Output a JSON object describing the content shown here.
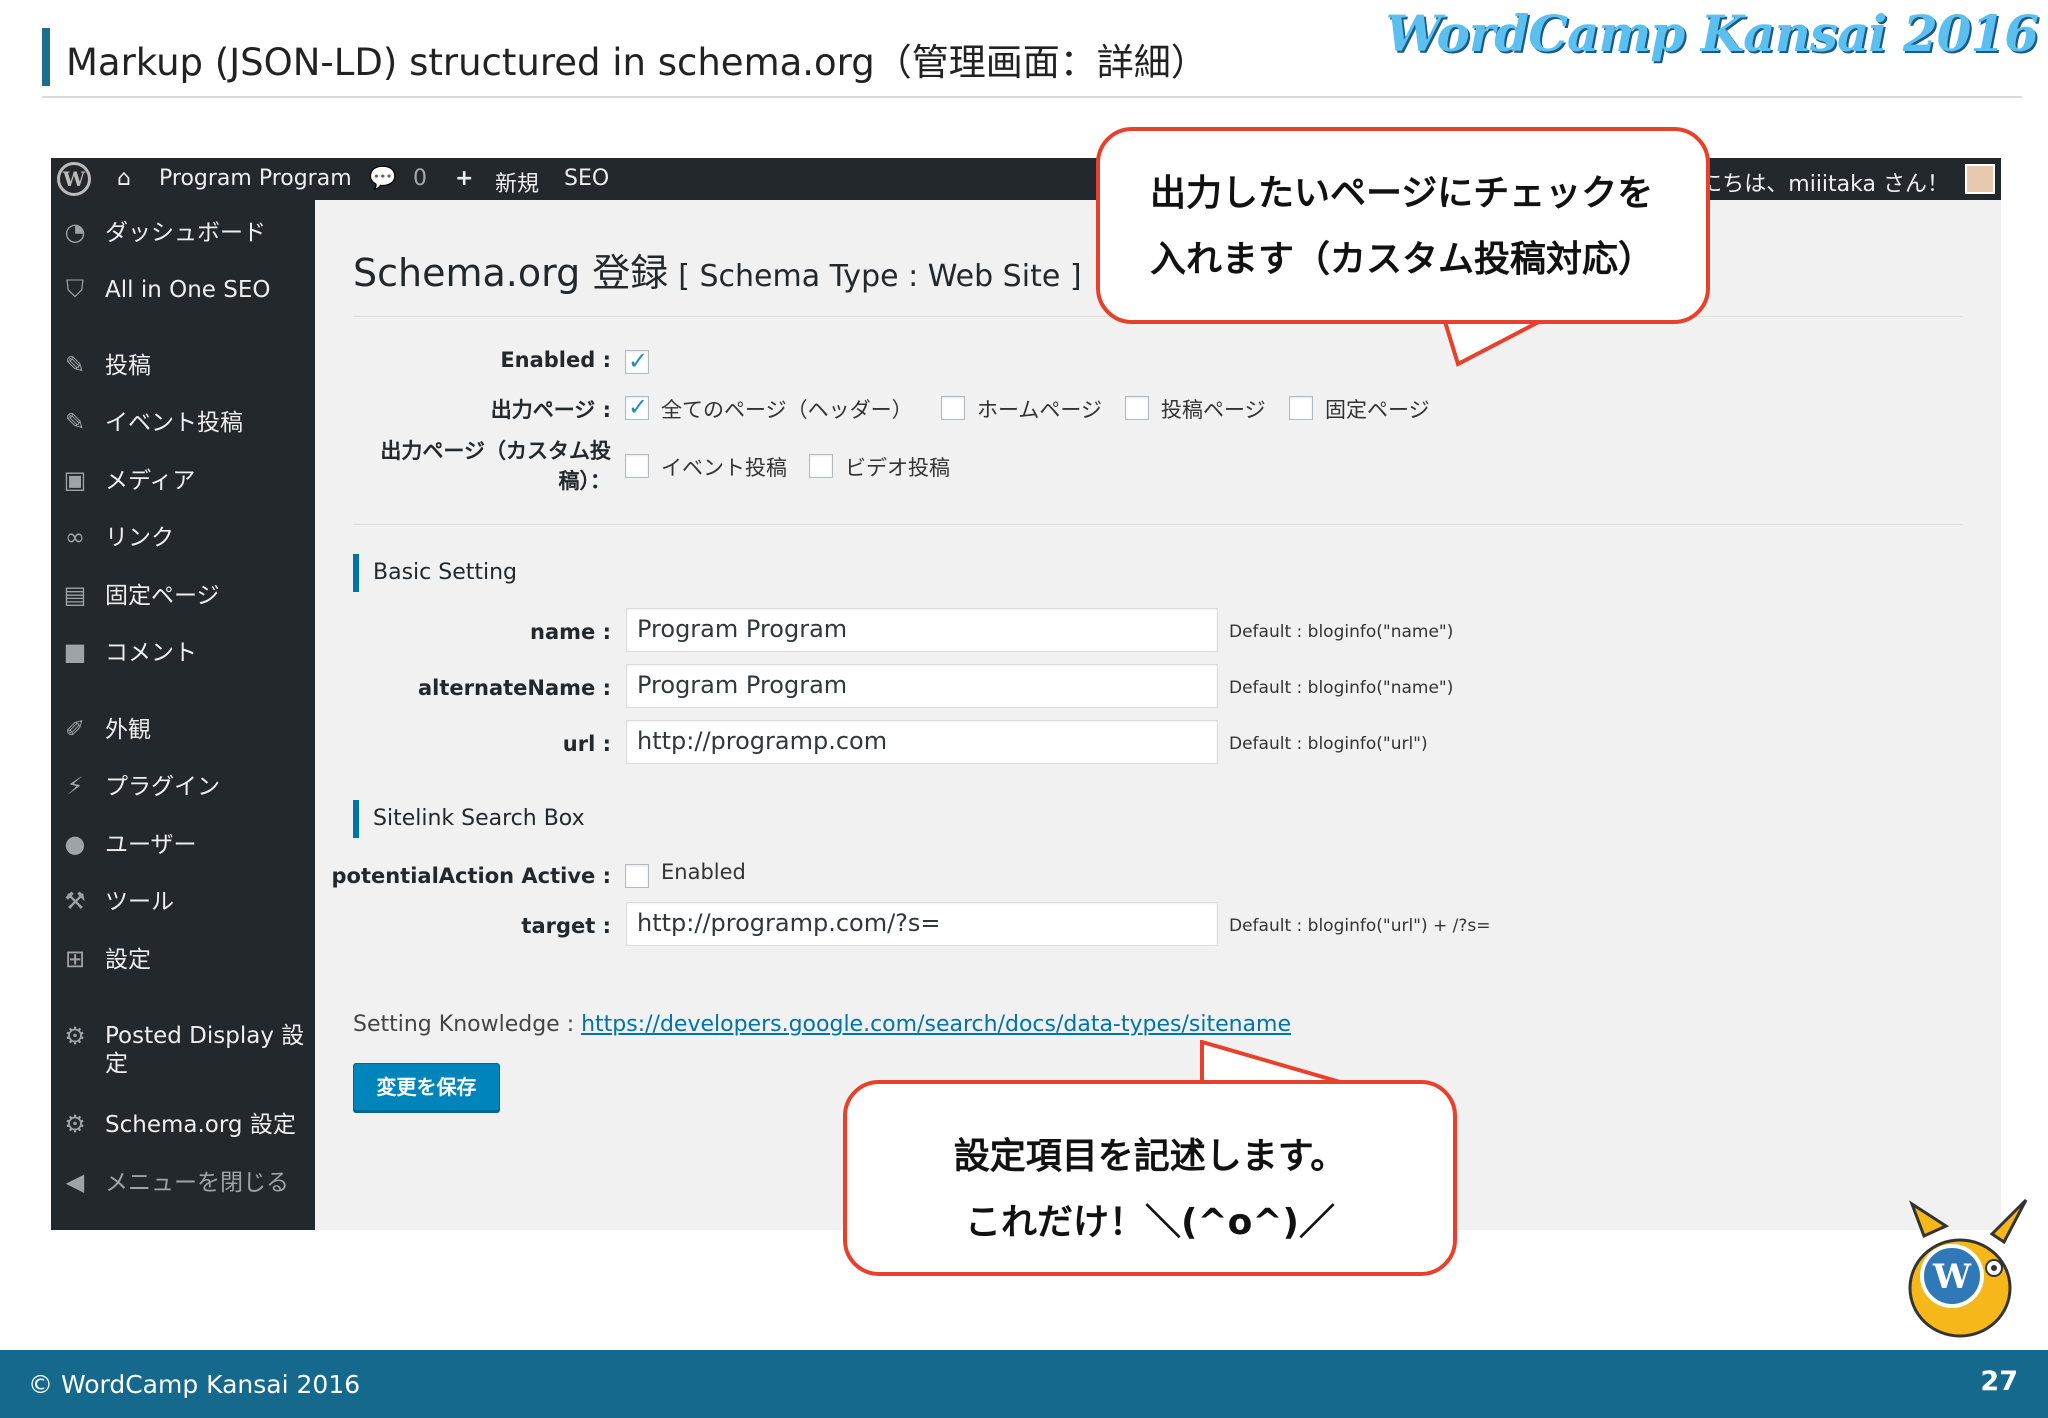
{
  "slide": {
    "title": "Markup (JSON-LD) structured in schema.org（管理画面：詳細）",
    "logo_text": "WordCamp Kansai 2016",
    "footer_copyright": "© WordCamp Kansai 2016",
    "page_number": "27"
  },
  "adminbar": {
    "site_name": "Program Program",
    "comments_count": "0",
    "new_label": "新規",
    "seo_label": "SEO",
    "greeting": "こんにちは、miiitaka さん！"
  },
  "sidebar": {
    "items": [
      {
        "label": "ダッシュボード",
        "icon": "dashboard-icon"
      },
      {
        "label": "All in One SEO",
        "icon": "shield-icon"
      },
      {
        "label": "投稿",
        "icon": "pin-icon"
      },
      {
        "label": "イベント投稿",
        "icon": "pin-icon"
      },
      {
        "label": "メディア",
        "icon": "media-icon"
      },
      {
        "label": "リンク",
        "icon": "link-icon"
      },
      {
        "label": "固定ページ",
        "icon": "page-icon"
      },
      {
        "label": "コメント",
        "icon": "comment-icon"
      },
      {
        "label": "外観",
        "icon": "paintbrush-icon"
      },
      {
        "label": "プラグイン",
        "icon": "plugin-icon"
      },
      {
        "label": "ユーザー",
        "icon": "user-icon"
      },
      {
        "label": "ツール",
        "icon": "wrench-icon"
      },
      {
        "label": "設定",
        "icon": "settings-icon"
      },
      {
        "label": "Posted Display 設定",
        "icon": "gear-icon"
      },
      {
        "label": "Schema.org 設定",
        "icon": "gear-icon"
      },
      {
        "label": "メニューを閉じる",
        "icon": "collapse-icon"
      }
    ]
  },
  "main": {
    "title": "Schema.org 登録",
    "subtitle": "[ Schema Type : Web Site ]",
    "enabled_label": "Enabled :",
    "enabled_checked": true,
    "output_label": "出力ページ :",
    "output_options": [
      {
        "label": "全てのページ（ヘッダー）",
        "checked": true
      },
      {
        "label": "ホームページ",
        "checked": false
      },
      {
        "label": "投稿ページ",
        "checked": false
      },
      {
        "label": "固定ページ",
        "checked": false
      }
    ],
    "custom_output_label_line1": "出力ページ（カスタム投",
    "custom_output_label_line2": "稿）：",
    "custom_options": [
      {
        "label": "イベント投稿",
        "checked": false
      },
      {
        "label": "ビデオ投稿",
        "checked": false
      }
    ],
    "basic_section": "Basic Setting",
    "fields": [
      {
        "label": "name :",
        "value": "Program Program",
        "hint": "Default : bloginfo(\"name\")"
      },
      {
        "label": "alternateName :",
        "value": "Program Program",
        "hint": "Default : bloginfo(\"name\")"
      },
      {
        "label": "url :",
        "value": "http://programp.com",
        "hint": "Default : bloginfo(\"url\")"
      }
    ],
    "sitelink_section": "Sitelink Search Box",
    "potential_label": "potentialAction Active :",
    "potential_option": "Enabled",
    "target_label": "target :",
    "target_value": "http://programp.com/?s=",
    "target_hint": "Default : bloginfo(\"url\") + /?s=",
    "knowledge_label": "Setting Knowledge :",
    "knowledge_link": "https://developers.google.com/search/docs/data-types/sitename",
    "save_button": "変更を保存"
  },
  "callouts": {
    "top_line1": "出力したいページにチェックを",
    "top_line2": "入れます（カスタム投稿対応）",
    "bottom_line1": "設定項目を記述します。",
    "bottom_line2": "これだけ！＼(^o^)／"
  },
  "colors": {
    "accent": "#1b6f8c",
    "callout_border": "#e8412b",
    "wp_blue": "#0085ba",
    "admin_dark": "#23282d",
    "footer": "#15698c"
  }
}
